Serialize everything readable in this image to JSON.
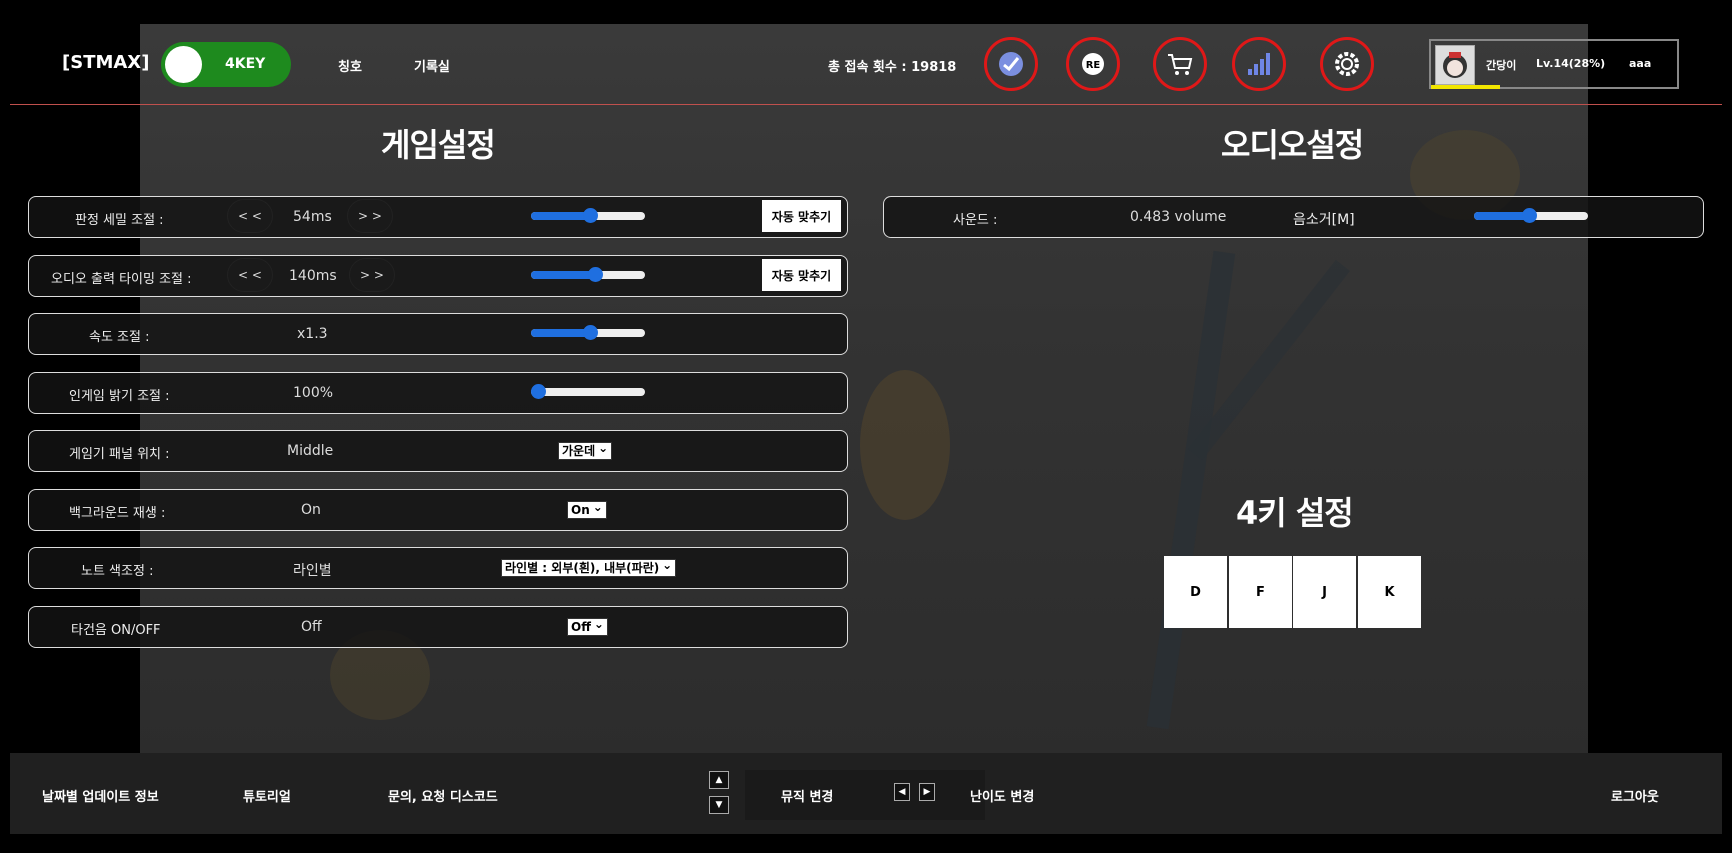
{
  "header": {
    "brand": "[STMAX]",
    "mode_toggle_label": "4KEY",
    "nav": [
      "칭호",
      "기록실"
    ],
    "visits": "총 접속 횟수 : 19818",
    "icons": [
      "check-icon",
      "re-icon",
      "cart-icon",
      "signal-bars-icon",
      "gear-icon"
    ],
    "profile": {
      "name": "간당이",
      "level": "Lv.14(28%)",
      "user": "aaa",
      "xp_fraction": 0.28
    }
  },
  "game_settings": {
    "title": "게임설정",
    "rows": [
      {
        "label": "판정 세밀 조절 :",
        "value": "54ms",
        "dec": "< <",
        "inc": "> >",
        "slider": 0.52,
        "button": "자동 맞추기"
      },
      {
        "label": "오디오 출력 타이밍 조절 :",
        "value": "140ms",
        "dec": "< <",
        "inc": "> >",
        "slider": 0.56,
        "button": "자동 맞추기"
      },
      {
        "label": "속도 조절 :",
        "value": "x1.3",
        "slider": 0.52
      },
      {
        "label": "인게임 밝기 조절 :",
        "value": "100%",
        "slider": 0.0
      },
      {
        "label": "게임기 패널 위치 :",
        "value": "Middle",
        "select": "가운데"
      },
      {
        "label": "백그라운드 재생 :",
        "value": "On",
        "select": "On"
      },
      {
        "label": "노트 색조정 :",
        "value": "라인별",
        "select": "라인별 : 외부(흰), 내부(파란)"
      },
      {
        "label": "타건음 ON/OFF",
        "value": "Off",
        "select": "Off"
      }
    ]
  },
  "audio_settings": {
    "title": "오디오설정",
    "sound_label": "사운드 :",
    "sound_value": "0.483 volume",
    "mute_label": "음소거[M]",
    "slider": 0.483
  },
  "key_settings": {
    "title": "4키 설정",
    "keys": [
      "D",
      "F",
      "J",
      "K"
    ]
  },
  "footer": {
    "updates": "날짜별 업데이트 정보",
    "tutorial": "튜토리얼",
    "discord": "문의, 요청 디스코드",
    "music_change": "뮤직 변경",
    "difficulty_change": "난이도 변경",
    "logout": "로그아웃"
  }
}
